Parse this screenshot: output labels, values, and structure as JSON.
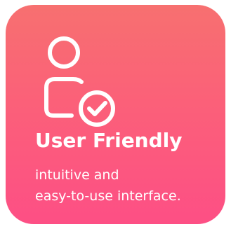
{
  "card": {
    "icon": "user-check-icon",
    "title": "User Friendly",
    "description_lines": [
      "intuitive and",
      "easy-to-use interface."
    ],
    "colors": {
      "gradient_top": "#f77070",
      "gradient_bottom": "#fd4f85",
      "text": "#ffffff"
    }
  }
}
